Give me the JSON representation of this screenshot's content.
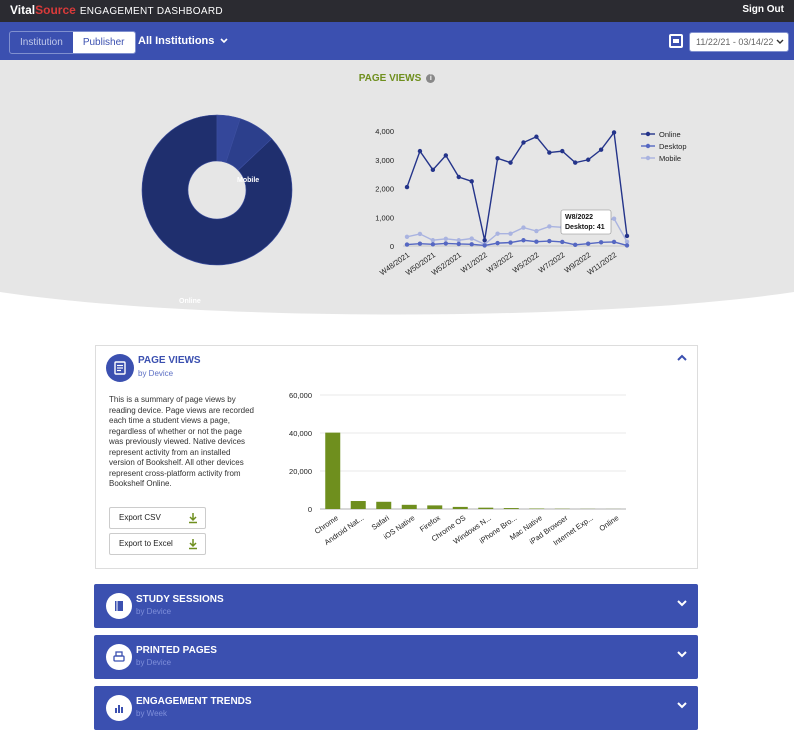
{
  "header": {
    "brand_part1": "Vital",
    "brand_part2": "Source",
    "brand_sub": "ENGAGEMENT DASHBOARD",
    "signout": "Sign Out"
  },
  "nav": {
    "toggle_institution": "Institution",
    "toggle_publisher": "Publisher",
    "selected_toggle": "Publisher",
    "institutions": "All Institutions",
    "date_range": "11/22/21 - 03/14/22"
  },
  "hero": {
    "title": "PAGE VIEWS",
    "info_glyph": "i",
    "donut": {
      "labels": [
        "Online",
        "Mobile"
      ],
      "slices": [
        {
          "name": "Online",
          "fraction": 0.87,
          "color": "#1f2f6e"
        },
        {
          "name": "Mobile",
          "fraction": 0.08,
          "color": "#2c3f8c"
        },
        {
          "name": "Desktop",
          "fraction": 0.05,
          "color": "#34479a"
        }
      ]
    },
    "tooltip": {
      "title": "W8/2022",
      "text": "Desktop: 41"
    }
  },
  "chart_data": [
    {
      "type": "line",
      "title": "",
      "x": [
        "W48/2021",
        "W49/2021",
        "W50/2021",
        "W51/2021",
        "W52/2021",
        "W53/2021",
        "W1/2022",
        "W2/2022",
        "W3/2022",
        "W4/2022",
        "W5/2022",
        "W6/2022",
        "W7/2022",
        "W8/2022",
        "W9/2022",
        "W10/2022",
        "W11/2022"
      ],
      "x_ticks": [
        "W48/2021",
        "W50/2021",
        "W52/2021",
        "W1/2022",
        "W3/2022",
        "W5/2022",
        "W7/2022",
        "W9/2022",
        "W11/2022"
      ],
      "y_ticks": [
        "0",
        "1,000",
        "2,000",
        "3,000",
        "4,000"
      ],
      "ylim": [
        0,
        4200
      ],
      "series": [
        {
          "name": "Online",
          "color": "#24348a",
          "values": [
            2050,
            3300,
            2650,
            3150,
            2400,
            2250,
            200,
            3050,
            2900,
            3600,
            3800,
            3250,
            3300,
            2900,
            3000,
            3350,
            3950,
            350
          ]
        },
        {
          "name": "Desktop",
          "color": "#5567c2",
          "values": [
            50,
            80,
            60,
            90,
            70,
            60,
            20,
            100,
            120,
            200,
            150,
            170,
            140,
            41,
            80,
            130,
            140,
            20
          ]
        },
        {
          "name": "Mobile",
          "color": "#a9b3e0",
          "values": [
            320,
            420,
            200,
            250,
            200,
            260,
            60,
            430,
            430,
            640,
            520,
            680,
            650,
            600,
            700,
            850,
            950,
            150
          ]
        }
      ],
      "legend": "top-right",
      "grid": false
    },
    {
      "type": "bar",
      "title": "",
      "categories": [
        "Chrome",
        "Android Nat...",
        "Safari",
        "iOS Native",
        "Firefox",
        "Chrome OS",
        "Windows N...",
        "iPhone Bro...",
        "Mac Native",
        "iPad Browser",
        "Internet Exp...",
        "Online"
      ],
      "values": [
        40200,
        4200,
        3800,
        2200,
        1900,
        1100,
        700,
        500,
        250,
        150,
        80,
        40
      ],
      "y_ticks": [
        "0",
        "20,000",
        "40,000",
        "60,000"
      ],
      "ylim": [
        0,
        60000
      ],
      "grid": true,
      "color": "#6f8f1e"
    }
  ],
  "panel": {
    "title": "PAGE VIEWS",
    "subtitle": "by Device",
    "description": "This is a summary of page views by reading device. Page views are recorded each time a student views a page, regardless of whether or not the page was previously viewed. Native devices represent activity from an installed version of Bookshelf. All other devices represent cross-platform activity from Bookshelf Online.",
    "export_csv": "Export CSV",
    "export_excel": "Export to Excel"
  },
  "sections": [
    {
      "title": "STUDY SESSIONS",
      "subtitle": "by Device",
      "icon": "book-icon"
    },
    {
      "title": "PRINTED PAGES",
      "subtitle": "by Device",
      "icon": "printer-icon"
    },
    {
      "title": "ENGAGEMENT TRENDS",
      "subtitle": "by Week",
      "icon": "bar-chart-icon"
    }
  ],
  "colors": {
    "brand_blue": "#3b50b0",
    "accent_green": "#6f8f1e",
    "topbar": "#2b2b31"
  }
}
